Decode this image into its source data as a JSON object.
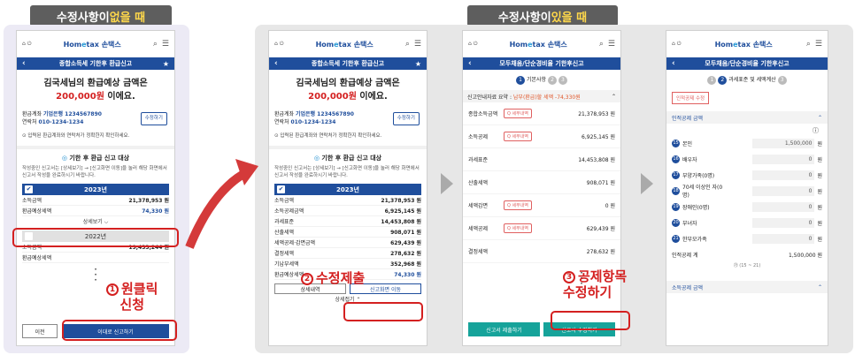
{
  "banners": {
    "left_pre": "수정사항이 ",
    "left_hl": "없을 때",
    "right_pre": "수정사항이 ",
    "right_hl": "있을 때"
  },
  "header": {
    "home": "홈",
    "logout": "로그아웃",
    "logo_a": "Hom",
    "logo_b": "e",
    "logo_c": "tax 손택스",
    "search": "검색",
    "menu": "전체메뉴"
  },
  "p1": {
    "nav": "종합소득세 기한후 환급신고",
    "greet1": "김국세님의 환급예상 금액은",
    "amount": "200,000원",
    "greet2": " 이에요.",
    "acct_label": "환급계좌 ",
    "acct_val": "기업은행 1234567890",
    "phone_label": "연락처 ",
    "phone_val": "010-1234-1234",
    "edit_btn": "수정하기",
    "note": "⊙ 입력된 환급계좌와 연락처가 정확한지 확인하세요.",
    "sect_title": "기한 후 환급 신고 대상",
    "sect_desc": "작성중인 신고서는 [상세보기] → [신고화면 이동]을 눌러 해당 화면에서 신고서 작성을 완료하시기 바랍니다.",
    "year1": "2023년",
    "r1l": "소득금액",
    "r1v": "21,378,953 원",
    "r2l": "환급예상세액",
    "r2v": "74,330 원",
    "more": "상세보기 ⌵",
    "year2": "2022년",
    "r3l": "소득금액",
    "r3v": "19,433,244 원",
    "r4l": "환급예상세액",
    "r4v": "",
    "btn_prev": "이전",
    "btn_submit": "이대로 신고하기",
    "callout": "원클릭\n신청",
    "callout_num": "1"
  },
  "p2": {
    "nav": "종합소득세 기한후 환급신고",
    "year1": "2023년",
    "rows": [
      {
        "l": "소득금액",
        "v": "21,378,953 원"
      },
      {
        "l": "소득공제금액",
        "v": "6,925,145 원"
      },
      {
        "l": "과세표준",
        "v": "14,453,808 원"
      },
      {
        "l": "산출세액",
        "v": "908,071 원"
      },
      {
        "l": "세액공제·감면금액",
        "v": "629,439 원"
      },
      {
        "l": "결정세액",
        "v": "278,632 원"
      },
      {
        "l": "기납부세액",
        "v": "352,968 원"
      },
      {
        "l": "환급예상세액",
        "v": "74,330 원"
      }
    ],
    "btn_detail": "상세내역",
    "btn_move": "신고화면 이동",
    "collapse": "상세접기 ⌃",
    "callout": "수정제출",
    "callout_num": "2"
  },
  "p3": {
    "nav": "모두채움/단순경비율 기한후신고",
    "step": "기본사항",
    "summary_label": "신고안내자료 요약 : ",
    "summary_val": "납부(환급)할 세액 -74,330원",
    "tag": "Q 세부내역",
    "rows": [
      {
        "l": "종합소득금액",
        "tag": true,
        "v": "21,378,953 원"
      },
      {
        "l": "소득공제",
        "tag": true,
        "v": "6,925,145 원"
      },
      {
        "l": "과세표준",
        "tag": false,
        "v": "14,453,808 원"
      },
      {
        "l": "산출세액",
        "tag": false,
        "v": "908,071 원"
      },
      {
        "l": "세액감면",
        "tag": true,
        "v": "0 원"
      },
      {
        "l": "세액공제",
        "tag": true,
        "v": "629,439 원"
      },
      {
        "l": "결정세액",
        "tag": false,
        "v": "278,632 원"
      }
    ],
    "btn_a": "신고서 제출하기",
    "btn_b": "신고서 수정하기",
    "callout": "공제항목\n수정하기",
    "callout_num": "3"
  },
  "p4": {
    "nav": "모두채움/단순경비율 기한후신고",
    "step": "과세표준 및 세액계산",
    "tag": "인적공제 수정",
    "sect1": "인적공제 금액",
    "rows": [
      {
        "n": "15",
        "l": "본인",
        "v": "1,500,000"
      },
      {
        "n": "16",
        "l": "배우자",
        "v": "0"
      },
      {
        "n": "17",
        "l": "부양가족(0명)",
        "v": "0"
      },
      {
        "n": "18",
        "l": "70세 이상인 자(0명)",
        "v": "0"
      },
      {
        "n": "19",
        "l": "장애인(0명)",
        "v": "0"
      },
      {
        "n": "20",
        "l": "부녀자",
        "v": "0"
      },
      {
        "n": "21",
        "l": "한부모가족",
        "v": "0"
      }
    ],
    "total_l": "인적공제 계",
    "total_v": "1,500,000 원",
    "total_sub": "㉮ (15 ~ 21)",
    "sect2": "소득공제 금액",
    "unit": "원"
  }
}
